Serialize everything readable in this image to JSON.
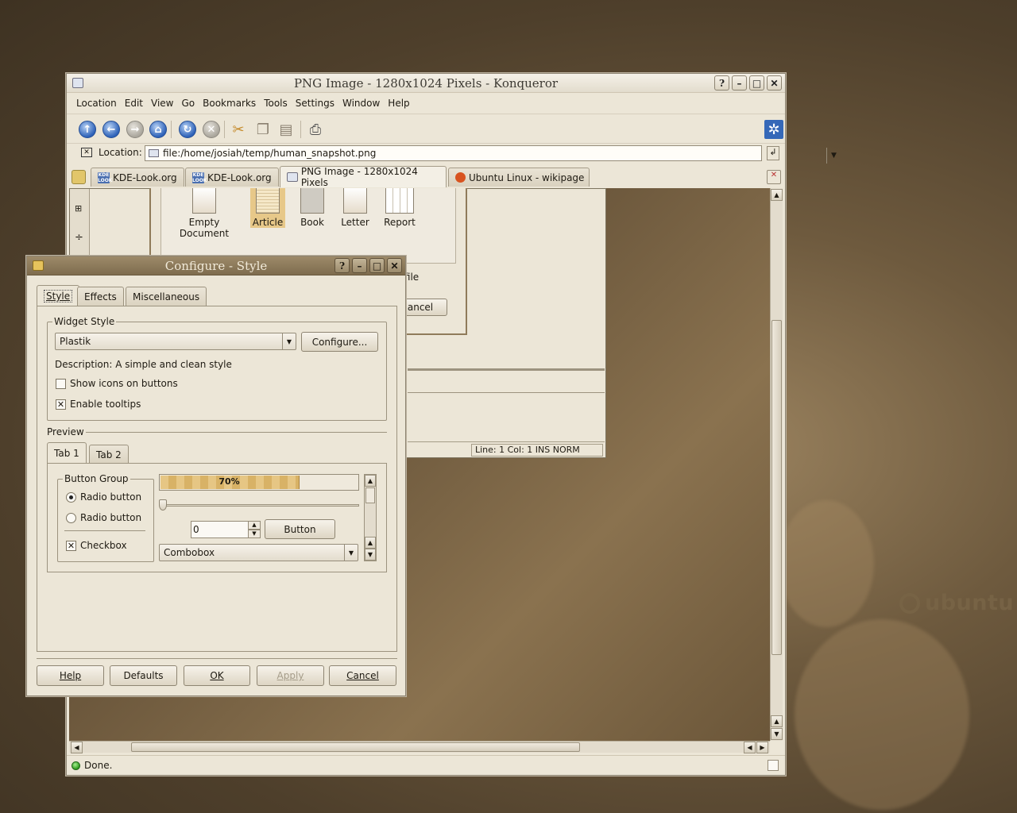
{
  "konqueror": {
    "title": "PNG Image - 1280x1024 Pixels - Konqueror",
    "menu": [
      "Location",
      "Edit",
      "View",
      "Go",
      "Bookmarks",
      "Tools",
      "Settings",
      "Window",
      "Help"
    ],
    "location_label": "Location:",
    "location_value": "file:/home/josiah/temp/human_snapshot.png",
    "tabs": [
      "KDE-Look.org",
      "KDE-Look.org",
      "PNG Image - 1280x1024 Pixels",
      "Ubuntu Linux - wikipage"
    ],
    "status": "Done."
  },
  "inner_app": {
    "doc_types": [
      "Empty Document",
      "Article",
      "Book",
      "Letter",
      "Report"
    ],
    "partial_text": "y file",
    "partial_button": "ancel",
    "status": "Line: 1 Col: 1  INS  NORM"
  },
  "desktop": {
    "logo_text": "ubuntu"
  },
  "dialog": {
    "title": "Configure - Style",
    "tabs": [
      "Style",
      "Effects",
      "Miscellaneous"
    ],
    "widget_style_group": "Widget Style",
    "widget_style_value": "Plastik",
    "configure_button": "Configure...",
    "description": "Description: A simple and clean style",
    "show_icons_label": "Show icons on buttons",
    "show_icons_checked": false,
    "enable_tooltips_label": "Enable tooltips",
    "enable_tooltips_checked": true,
    "preview_label": "Preview",
    "preview_tabs": [
      "Tab 1",
      "Tab 2"
    ],
    "button_group_title": "Button Group",
    "radio1": "Radio button",
    "radio2": "Radio button",
    "checkbox": "Checkbox",
    "progress_text": "70%",
    "progress_value": 0.7,
    "spin_value": "0",
    "button_label": "Button",
    "combobox_value": "Combobox",
    "buttons": {
      "help": "Help",
      "defaults": "Defaults",
      "ok": "OK",
      "apply": "Apply",
      "cancel": "Cancel"
    }
  }
}
